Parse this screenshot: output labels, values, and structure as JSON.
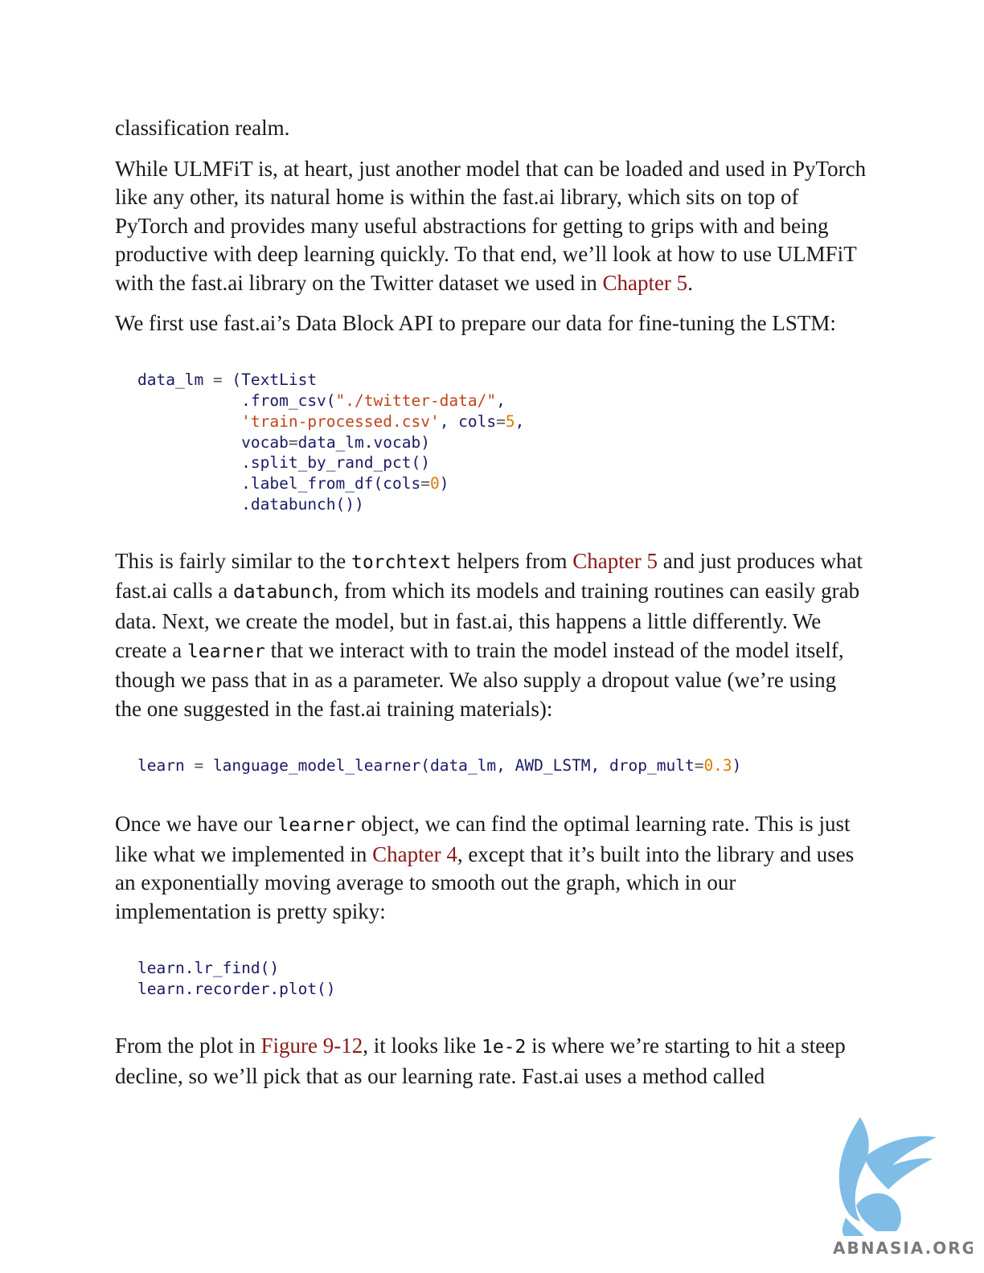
{
  "p1": "classification realm.",
  "p2": {
    "t1": "While ULMFiT is, at heart, just another model that can be loaded and used in PyTorch like any other, its natural home is within the fast.ai library, which sits on top of PyTorch and provides many useful abstractions for getting to grips with and being productive with deep learning quickly. To that end, we’ll look at how to use ULMFiT with the fast.ai library on the Twitter dataset we used in ",
    "link": "Chapter 5",
    "t2": "."
  },
  "p3": "We first use fast.ai’s Data Block API to prepare our data for fine-tuning the LSTM:",
  "code1": {
    "l1a": "data_lm ",
    "l1b": "=",
    "l1c": " (TextList",
    "l2a": "           .from_csv(",
    "l2s": "\"./twitter-data/\"",
    "l2b": ",",
    "l3s": "           'train-processed.csv'",
    "l3a": ", cols",
    "l3b": "=",
    "l3n": "5",
    "l3c": ",",
    "l4a": "           vocab",
    "l4b": "=",
    "l4c": "data_lm.vocab)",
    "l5": "           .split_by_rand_pct()",
    "l6a": "           .label_from_df(cols",
    "l6b": "=",
    "l6n": "0",
    "l6c": ")",
    "l7": "           .databunch())"
  },
  "p4": {
    "t1": "This is fairly similar to the ",
    "c1": "torchtext",
    "t2": " helpers from ",
    "link": "Chapter 5",
    "t3": " and just produces what fast.ai calls a ",
    "c2": "databunch",
    "t4": ", from which its models and training routines can easily grab data. Next, we create the model, but in fast.ai, this happens a little differently. We create a ",
    "c3": "learner",
    "t5": " that we interact with to train the model instead of the model itself, though we pass that in as a parameter. We also supply a dropout value (we’re using the one suggested in the fast.ai training materials):"
  },
  "code2": {
    "a": "learn ",
    "b": "=",
    "c": " language_model_learner(data_lm, AWD_LSTM, drop_mult",
    "d": "=",
    "n": "0.3",
    "e": ")"
  },
  "p5": {
    "t1": "Once we have our ",
    "c1": "learner",
    "t2": " object, we can find the optimal learning rate. This is just like what we implemented in ",
    "link": "Chapter 4",
    "t3": ", except that it’s built into the library and uses an exponentially moving average to smooth out the graph, which in our implementation is pretty spiky:"
  },
  "code3": {
    "l1": "learn.lr_find()",
    "l2": "learn.recorder.plot()"
  },
  "p6": {
    "t1": "From the plot in ",
    "link": "Figure 9-12",
    "t2": ", it looks like ",
    "c1": "1e-2",
    "t3": " is where we’re starting to hit a steep decline, so we’ll pick that as our learning rate. Fast.ai uses a method called"
  },
  "watermark": {
    "text": "ABNASIA.ORG",
    "icon": "griffin-logo-icon",
    "color": "#7fbde6"
  }
}
